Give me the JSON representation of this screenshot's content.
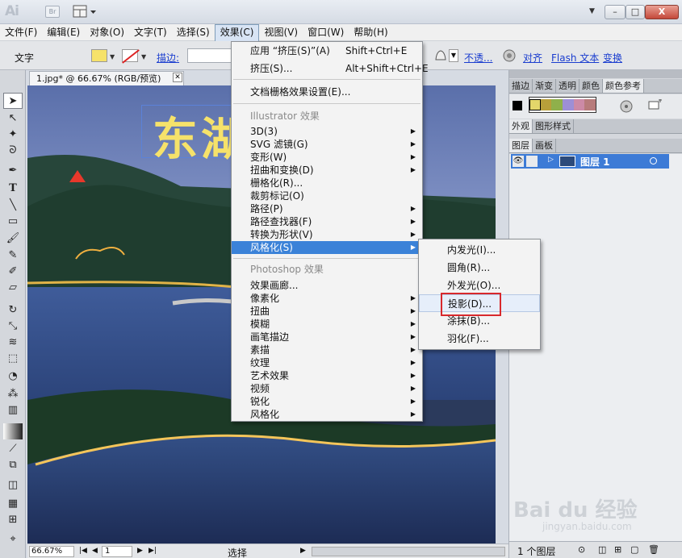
{
  "title_bar": {
    "app_logo": "Ai",
    "bridge_badge": "Br",
    "arrange_icon": "arrange-documents-icon",
    "min": "–",
    "max": "□",
    "close": "X"
  },
  "menubar": {
    "items": [
      "文件(F)",
      "编辑(E)",
      "对象(O)",
      "文字(T)",
      "选择(S)",
      "效果(C)",
      "视图(V)",
      "窗口(W)",
      "帮助(H)"
    ],
    "active": "效果(C)"
  },
  "control_bar": {
    "tool_label": "文字",
    "stroke_label": "描边:",
    "opacity_label": "不透...",
    "align_label": "对齐",
    "flash_label": "Flash 文本",
    "transform_label": "变换"
  },
  "document": {
    "tab_title": "1.jpg* @ 66.67% (RGB/预览)",
    "text_art": "东湖"
  },
  "status_bar": {
    "zoom": "66.67%",
    "page": "1",
    "status": "选择"
  },
  "panels": {
    "top_tabs": [
      "描边",
      "渐变",
      "透明",
      "颜色",
      "颜色参考"
    ],
    "appearance_tabs": [
      "外观",
      "图形样式"
    ],
    "layer_tabs": [
      "图层",
      "画板"
    ],
    "layer_name": "图层 1",
    "layers_count": "1 个图层",
    "harmony_colors": [
      "#e3d66a",
      "#b89f3a",
      "#8fb04b",
      "#9d8fd6",
      "#cc8aa6",
      "#b77b7b"
    ]
  },
  "effect_menu": {
    "apply": {
      "label": "应用 “挤压(S)”(A)",
      "shortcut": "Shift+Ctrl+E"
    },
    "squeeze": {
      "label": "挤压(S)...",
      "shortcut": "Alt+Shift+Ctrl+E"
    },
    "doc_raster": "文档栅格效果设置(E)...",
    "illustrator_header": "Illustrator 效果",
    "illustrator_items": [
      "3D(3)",
      "SVG 滤镜(G)",
      "变形(W)",
      "扭曲和变换(D)",
      "栅格化(R)...",
      "裁剪标记(O)",
      "路径(P)",
      "路径查找器(F)",
      "转换为形状(V)",
      "风格化(S)"
    ],
    "photoshop_header": "Photoshop 效果",
    "photoshop_items": [
      "效果画廊...",
      "像素化",
      "扭曲",
      "模糊",
      "画笔描边",
      "素描",
      "纹理",
      "艺术效果",
      "视频",
      "锐化",
      "风格化"
    ]
  },
  "stylize_submenu": {
    "items": [
      "内发光(I)...",
      "圆角(R)...",
      "外发光(O)...",
      "投影(D)...",
      "涂抹(B)...",
      "羽化(F)..."
    ]
  },
  "watermark": {
    "main": "Bai du 经验",
    "sub": "jingyan.baidu.com"
  }
}
